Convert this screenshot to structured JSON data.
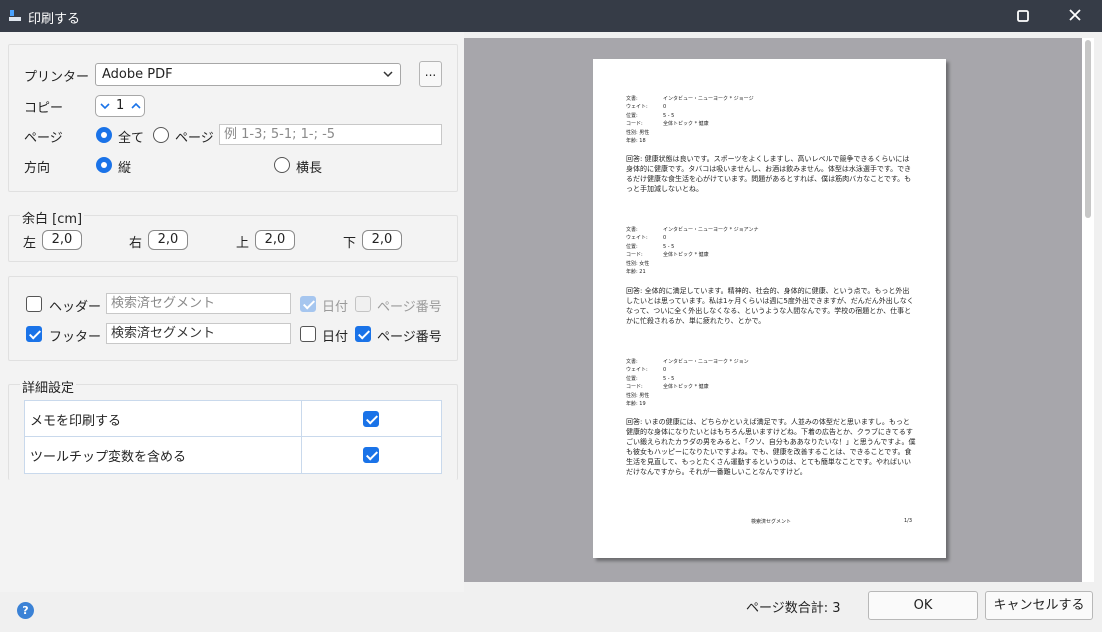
{
  "window": {
    "title": "印刷する"
  },
  "settings": {
    "printer_label": "プリンター",
    "printer_value": "Adobe PDF",
    "printer_browse": "...",
    "copies_label": "コピー",
    "copies_value": "1",
    "pages_label": "ページ",
    "pages_all": "全て",
    "pages_range": "ページ",
    "pages_placeholder": "例 1-3; 5-1; 1-; -5",
    "orientation_label": "方向",
    "portrait": "縦",
    "landscape": "横長"
  },
  "margins": {
    "title": "余白 [cm]",
    "left_label": "左",
    "left_value": "2,0",
    "right_label": "右",
    "right_value": "2,0",
    "top_label": "上",
    "top_value": "2,0",
    "bottom_label": "下",
    "bottom_value": "2,0"
  },
  "header_footer": {
    "header_label": "ヘッダー",
    "header_value": "検索済セグメント",
    "header_date": "日付",
    "header_page_number": "ページ番号",
    "footer_label": "フッター",
    "footer_value": "検索済セグメント",
    "footer_date": "日付",
    "footer_page_number": "ページ番号"
  },
  "advanced": {
    "title": "詳細設定",
    "rows": [
      {
        "label": "メモを印刷する",
        "checked": true
      },
      {
        "label": "ツールチップ変数を含める",
        "checked": true
      }
    ]
  },
  "preview_page": {
    "blocks": [
      {
        "meta": [
          [
            "文書:",
            "インタビュー・ニューヨーク * ジョージ"
          ],
          [
            "ウェイト:",
            "0"
          ],
          [
            "位置:",
            "5 - 5"
          ],
          [
            "コード:",
            "全体トピック * 健康"
          ],
          [
            "性別: 男性",
            ""
          ],
          [
            "年齢: 18",
            ""
          ]
        ],
        "text": "回答: 健康状態は良いです。スポーツをよくしますし、高いレベルで競争できるくらいには身体的に健康です。タバコは吸いませんし、お酒は飲みません。体型は水泳選手です。できるだけ健康な食生活を心がけています。問題があるとすれば、僕は筋肉バカなことです。もっと手加減しないとね。"
      },
      {
        "meta": [
          [
            "文書:",
            "インタビュー・ニューヨーク * ジョアンナ"
          ],
          [
            "ウェイト:",
            "0"
          ],
          [
            "位置:",
            "5 - 5"
          ],
          [
            "コード:",
            "全体トピック * 健康"
          ],
          [
            "性別: 女性",
            ""
          ],
          [
            "年齢: 21",
            ""
          ]
        ],
        "text": "回答: 全体的に満足しています。精神的、社会的、身体的に健康、という点で。もっと外出したいとは思っています。私は1ヶ月くらいは週に5度外出できますが、だんだん外出しなくなって、ついに全く外出しなくなる、というような人間なんです。学校の宿題とか、仕事とかに忙殺されるか、単に疲れたり、とかで。"
      },
      {
        "meta": [
          [
            "文書:",
            "インタビュー・ニューヨーク * ジョン"
          ],
          [
            "ウェイト:",
            "0"
          ],
          [
            "位置:",
            "5 - 5"
          ],
          [
            "コード:",
            "全体トピック * 健康"
          ],
          [
            "性別: 男性",
            ""
          ],
          [
            "年齢: 19",
            ""
          ]
        ],
        "text": "回答: いまの健康には、どちらかといえば満足です。人並みの体型だと思いますし。もっと健康的な身体になりたいとはもちろん思いますけどね。下着の広告とか、クラブにきてるすごい鍛えられたカラダの男をみると、「クソ、自分もああなりたいな！」と思うんですよ。僕も彼女もハッピーになりたいですよね。でも、健康を改善することは、できることです。食生活を見直して、もっとたくさん運動するというのは、とても簡単なことです。やればいいだけなんですから。それが一番難しいことなんですけど。"
      }
    ],
    "footer_left": "検索済セグメント",
    "footer_right": "1/3"
  },
  "footer": {
    "page_total": "ページ数合計: 3",
    "ok": "OK",
    "cancel": "キャンセルする"
  },
  "colors": {
    "accent": "#1a73e8",
    "titlebar": "#363c47",
    "preview_bg": "#a7a6ab"
  }
}
